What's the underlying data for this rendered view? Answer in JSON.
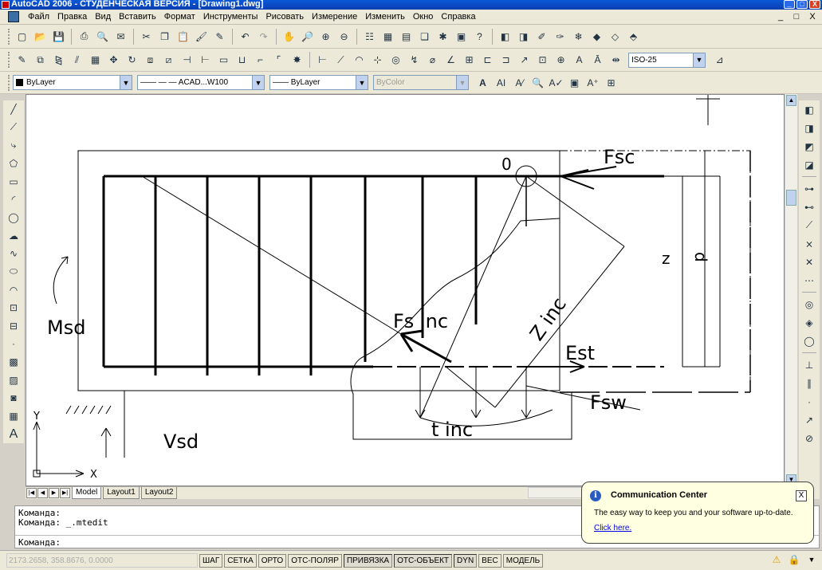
{
  "window": {
    "title": "AutoCAD 2006 - СТУДЕНЧЕСКАЯ ВЕРСИЯ - [Drawing1.dwg]",
    "controls": [
      "_",
      "□",
      "X"
    ]
  },
  "menubar": {
    "items": [
      "Файл",
      "Правка",
      "Вид",
      "Вставить",
      "Формат",
      "Инструменты",
      "Рисовать",
      "Измерение",
      "Изменить",
      "Окно",
      "Справка"
    ],
    "doc_controls": [
      "_",
      "□",
      "X"
    ]
  },
  "toolbar1": {
    "icons": [
      "new-icon",
      "open-icon",
      "save-icon",
      "print-icon",
      "preview-icon",
      "publish-icon",
      "cut-icon",
      "copy-icon",
      "paste-icon",
      "matchprop-icon",
      "brush-icon",
      "undo-icon",
      "redo-icon",
      "pan-icon",
      "zoom-realtime-icon",
      "zoom-window-icon",
      "zoom-previous-icon",
      "properties-icon",
      "designcenter-icon",
      "toolpalettes-icon",
      "sheetset-icon",
      "markup-icon",
      "calculator-icon",
      "help-icon",
      "layer-icon",
      "layer-prev-icon",
      "layer-state-icon",
      "layer-off-icon",
      "layer-freeze-icon",
      "layer-lock-icon",
      "layer-change-icon"
    ]
  },
  "toolbar2": {
    "dimstyle": "ISO-25"
  },
  "toolbar3": {
    "layer": "ByLayer",
    "linetype": "—— — —  ACAD...W100",
    "lineweight": "——  ByLayer",
    "plotstyle": "ByColor"
  },
  "drawing": {
    "labels": {
      "fsc": "Fsc",
      "origin": "0",
      "z": "z",
      "d": "d",
      "msd": "Msd",
      "fs_inc": "Fs inc",
      "z_inc": "Z inc",
      "est": "Est",
      "fsw": "Fsw",
      "t_inc": "t inc",
      "vsd": "Vsd",
      "ucs_y": "Y",
      "ucs_x": "X"
    }
  },
  "layout_tabs": [
    "Model",
    "Layout1",
    "Layout2"
  ],
  "command": {
    "line1": "Команда:",
    "line2": "Команда: _.mtedit",
    "prompt": "Команда:"
  },
  "status": {
    "coords": "2173.2658, 358.8676, 0.0000",
    "buttons": [
      "ШАГ",
      "СЕТКА",
      "ОРТО",
      "ОТС-ПОЛЯР",
      "ПРИВЯЗКА",
      "ОТС-ОБЪЕКТ",
      "DYN",
      "ВЕС",
      "МОДЕЛЬ"
    ]
  },
  "balloon": {
    "title": "Communication Center",
    "message": "The easy way to keep you and your software up-to-date.",
    "link": "Click here.",
    "close": "X"
  }
}
